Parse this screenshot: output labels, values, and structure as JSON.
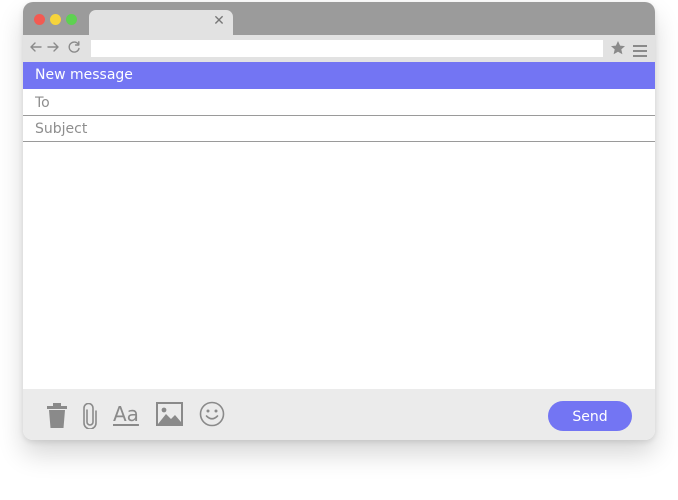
{
  "compose": {
    "title": "New message",
    "to_placeholder": "To",
    "subject_placeholder": "Subject",
    "body_value": ""
  },
  "browser": {
    "address_value": "",
    "tab_close_glyph": "✕"
  },
  "toolbar": {
    "format_label": "Aa",
    "send_label": "Send"
  },
  "icons": {
    "traffic_lights": [
      "close",
      "minimize",
      "zoom"
    ],
    "nav": [
      "arrow-back-icon",
      "arrow-forward-icon",
      "reload-icon"
    ],
    "browser_actions": [
      "star-icon",
      "menu-icon"
    ],
    "compose_tools": [
      "trash-icon",
      "paperclip-icon",
      "text-format-icon",
      "image-icon",
      "emoji-icon"
    ]
  },
  "colors": {
    "accent": "#7375f3",
    "titlebar": "#9b9b9b",
    "toolbar": "#e2e2e2",
    "bottom_bar": "#ebebeb",
    "icon_gray": "#8a8a8a",
    "traffic_red": "#f25a52",
    "traffic_yellow": "#f6d43b",
    "traffic_green": "#5ed151"
  }
}
